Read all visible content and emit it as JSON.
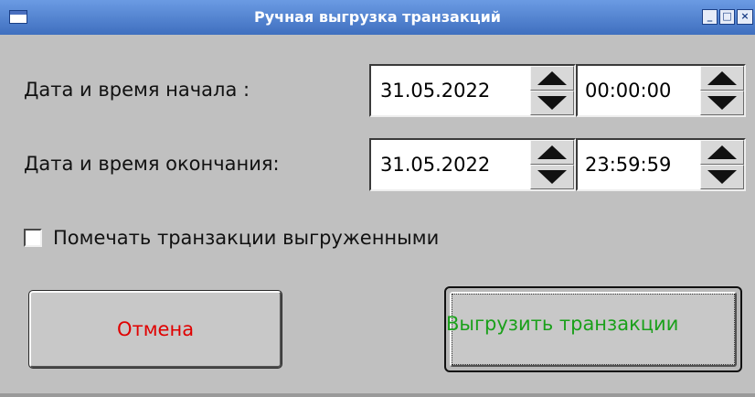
{
  "window": {
    "title": "Ручная выгрузка транзакций",
    "title_bar_color": "#3f6fbf",
    "controls": {
      "minimize_icon": "minimize-icon",
      "maximize_icon": "maximize-icon",
      "close_icon": "close-icon"
    }
  },
  "form": {
    "start": {
      "label": "Дата и время начала :",
      "date": "31.05.2022",
      "time": "00:00:00"
    },
    "end": {
      "label": "Дата и время окончания:",
      "date": "31.05.2022",
      "time": "23:59:59"
    },
    "mark_exported": {
      "label": "Помечать транзакции выгруженными",
      "checked": false
    }
  },
  "buttons": {
    "cancel": {
      "label": "Отмена",
      "color": "#e00000"
    },
    "export": {
      "label": "Выгрузить транзакции",
      "color": "#1aa01a"
    }
  }
}
